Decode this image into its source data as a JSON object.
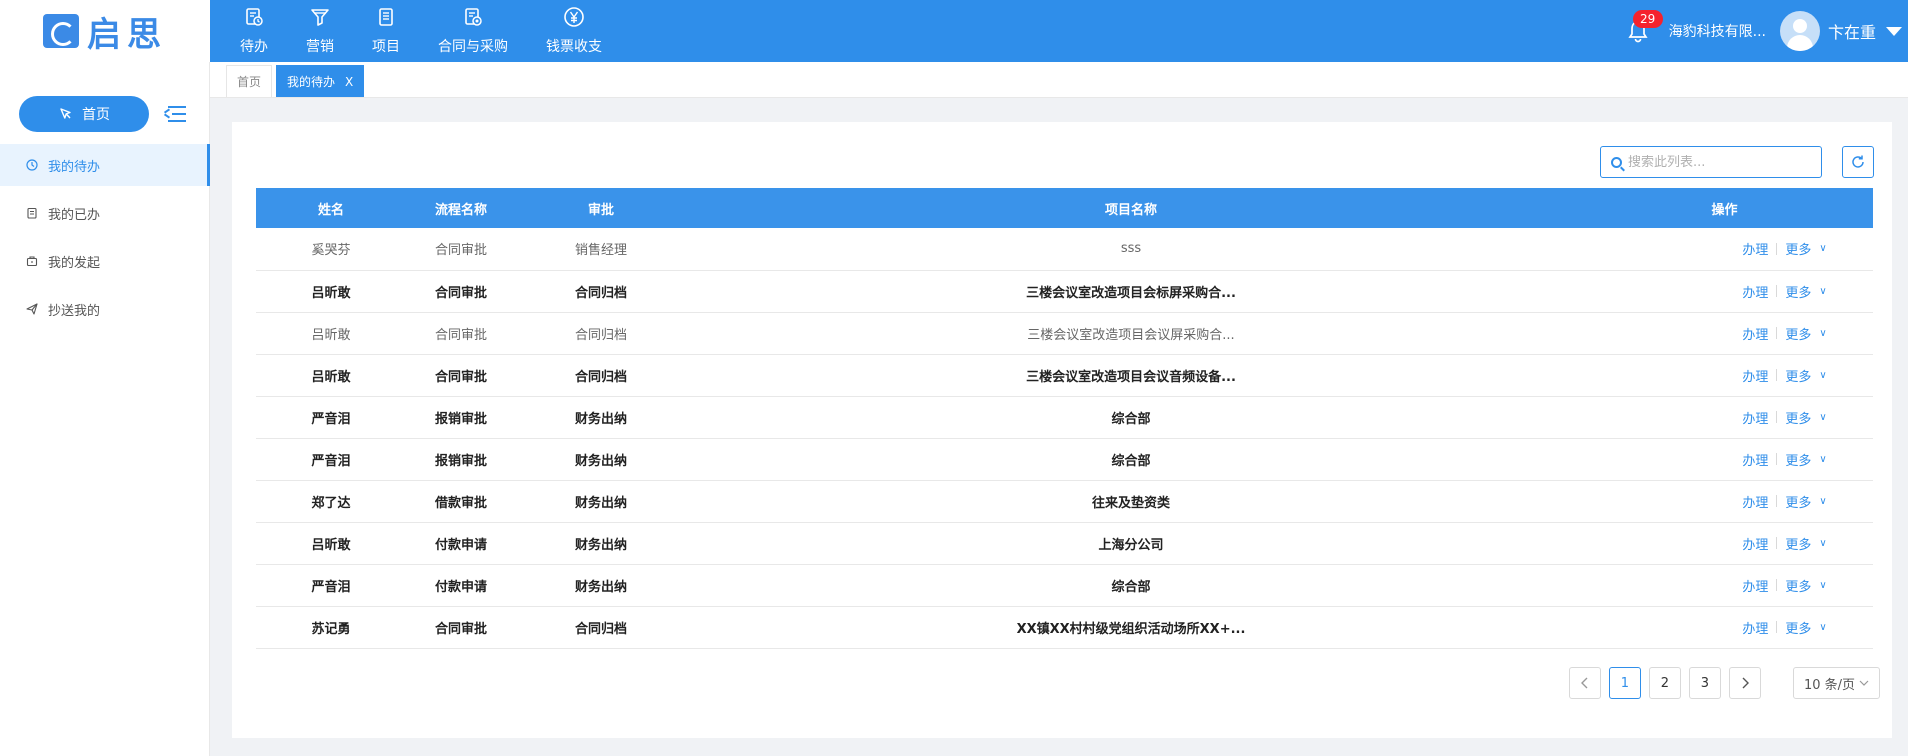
{
  "brand": {
    "logo_text": "启思"
  },
  "nav": [
    {
      "label": "待办",
      "icon": "todo-icon"
    },
    {
      "label": "营销",
      "icon": "funnel-icon"
    },
    {
      "label": "项目",
      "icon": "document-icon"
    },
    {
      "label": "合同与采购",
      "icon": "contract-icon"
    },
    {
      "label": "钱票收支",
      "icon": "yen-icon"
    }
  ],
  "header": {
    "notification_count": "29",
    "company": "海豹科技有限...",
    "user": "卞在重"
  },
  "sidebar": {
    "home_label": "首页",
    "items": [
      {
        "label": "我的待办",
        "icon": "clock-icon",
        "active": true
      },
      {
        "label": "我的已办",
        "icon": "clipboard-icon",
        "active": false
      },
      {
        "label": "我的发起",
        "icon": "briefcase-icon",
        "active": false
      },
      {
        "label": "抄送我的",
        "icon": "send-icon",
        "active": false
      }
    ]
  },
  "tabs": [
    {
      "label": "首页",
      "active": false
    },
    {
      "label": "我的待办",
      "active": true,
      "close": "X"
    }
  ],
  "search": {
    "placeholder": "搜索此列表..."
  },
  "table": {
    "headers": [
      "姓名",
      "流程名称",
      "审批",
      "项目名称",
      "操作"
    ],
    "rows": [
      {
        "name": "奚哭芬",
        "flow": "合同审批",
        "approve": "销售经理",
        "project": "sss",
        "bold": false
      },
      {
        "name": "吕昕敢",
        "flow": "合同审批",
        "approve": "合同归档",
        "project": "三楼会议室改造项目会标屏采购合...",
        "bold": true
      },
      {
        "name": "吕昕敢",
        "flow": "合同审批",
        "approve": "合同归档",
        "project": "三楼会议室改造项目会议屏采购合...",
        "bold": false
      },
      {
        "name": "吕昕敢",
        "flow": "合同审批",
        "approve": "合同归档",
        "project": "三楼会议室改造项目会议音频设备...",
        "bold": true
      },
      {
        "name": "严音泪",
        "flow": "报销审批",
        "approve": "财务出纳",
        "project": "综合部",
        "bold": true
      },
      {
        "name": "严音泪",
        "flow": "报销审批",
        "approve": "财务出纳",
        "project": "综合部",
        "bold": true
      },
      {
        "name": "郑了达",
        "flow": "借款审批",
        "approve": "财务出纳",
        "project": "往来及垫资类",
        "bold": true
      },
      {
        "name": "吕昕敢",
        "flow": "付款申请",
        "approve": "财务出纳",
        "project": "上海分公司",
        "bold": true
      },
      {
        "name": "严音泪",
        "flow": "付款申请",
        "approve": "财务出纳",
        "project": "综合部",
        "bold": true
      },
      {
        "name": "苏记勇",
        "flow": "合同审批",
        "approve": "合同归档",
        "project": "XX镇XX村村级党组织活动场所XX+...",
        "bold": true
      }
    ],
    "op_handle": "办理",
    "op_more": "更多"
  },
  "pagination": {
    "pages": [
      "1",
      "2",
      "3"
    ],
    "current": "1",
    "page_size": "10 条/页"
  },
  "colors": {
    "primary": "#2f8eea"
  }
}
